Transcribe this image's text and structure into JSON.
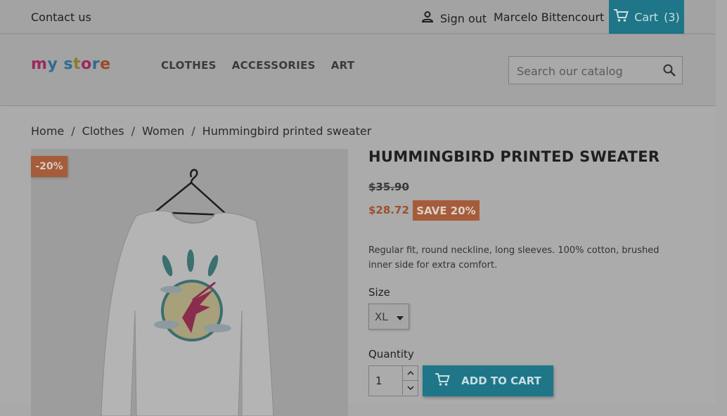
{
  "topbar": {
    "contact": "Contact us",
    "sign_out": "Sign out",
    "username": "Marcelo Bittencourt",
    "cart_label": "Cart",
    "cart_count": "(3)",
    "icons": {
      "user": "user-icon",
      "cart": "cart-icon"
    }
  },
  "header": {
    "logo": "my store",
    "nav": [
      "CLOTHES",
      "ACCESSORIES",
      "ART"
    ],
    "search_placeholder": "Search our catalog"
  },
  "breadcrumb": [
    "Home",
    "Clothes",
    "Women",
    "Hummingbird printed sweater"
  ],
  "product": {
    "discount_flag": "-20%",
    "title": "HUMMINGBIRD PRINTED SWEATER",
    "old_price": "$35.90",
    "price": "$28.72",
    "save_badge": "SAVE 20%",
    "description": "Regular fit, round neckline, long sleeves. 100% cotton, brushed inner side for extra comfort.",
    "size_label": "Size",
    "size_value": "XL",
    "quantity_label": "Quantity",
    "quantity_value": "1",
    "add_to_cart": "ADD TO CART"
  },
  "colors": {
    "accent": "#1e7688",
    "sale": "#a55c3a"
  }
}
